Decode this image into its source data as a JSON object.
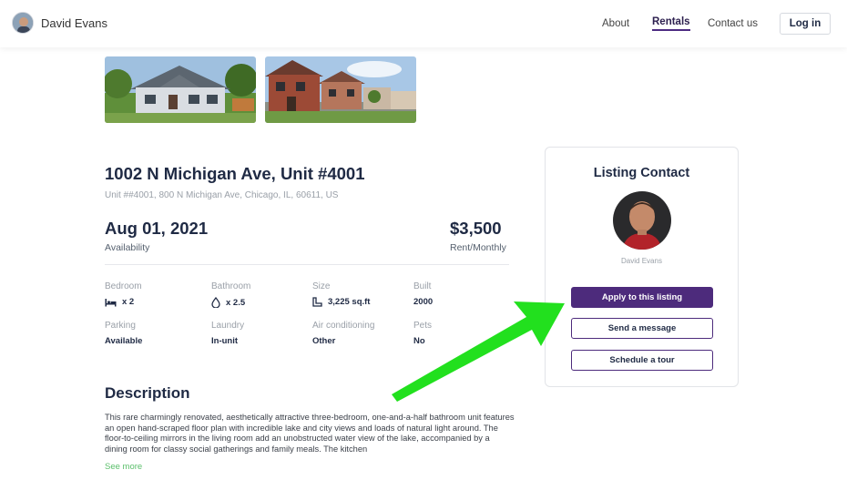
{
  "header": {
    "user_name": "David Evans",
    "nav": {
      "about": "About",
      "rentals": "Rentals",
      "contact": "Contact us"
    },
    "login_label": "Log in"
  },
  "listing": {
    "address": "1002 N Michigan Ave, Unit #4001",
    "address_full": "Unit ##4001, 800 N Michigan Ave, Chicago, IL, 60611, US",
    "availability_date": "Aug 01, 2021",
    "availability_label": "Availability",
    "price": "$3,500",
    "price_label": "Rent/Monthly",
    "features": {
      "bedroom": {
        "label": "Bedroom",
        "value": "x 2",
        "icon": "bed-icon"
      },
      "bathroom": {
        "label": "Bathroom",
        "value": "x 2.5",
        "icon": "water-drop-icon"
      },
      "size": {
        "label": "Size",
        "value": "3,225 sq.ft",
        "icon": "area-icon"
      },
      "built": {
        "label": "Built",
        "value": "2000"
      },
      "parking": {
        "label": "Parking",
        "value": "Available"
      },
      "laundry": {
        "label": "Laundry",
        "value": "In-unit"
      },
      "air_conditioning": {
        "label": "Air conditioning",
        "value": "Other"
      },
      "pets": {
        "label": "Pets",
        "value": "No"
      }
    },
    "description_title": "Description",
    "description": "This rare charmingly renovated, aesthetically attractive three-bedroom, one-and-a-half bathroom unit features an open hand-scraped floor plan with incredible lake and city views and loads of natural light around. The floor-to-ceiling mirrors in the living room add an unobstructed water view of the lake, accompanied by a dining room for classy social gatherings and family meals. The kitchen",
    "see_more": "See more"
  },
  "contact_card": {
    "title": "Listing Contact",
    "name": "David Evans",
    "apply_label": "Apply to this listing",
    "message_label": "Send a message",
    "tour_label": "Schedule a tour"
  },
  "colors": {
    "accent": "#4d2b7c",
    "annotation_arrow": "#22e01e",
    "link": "#5bbf6b"
  }
}
